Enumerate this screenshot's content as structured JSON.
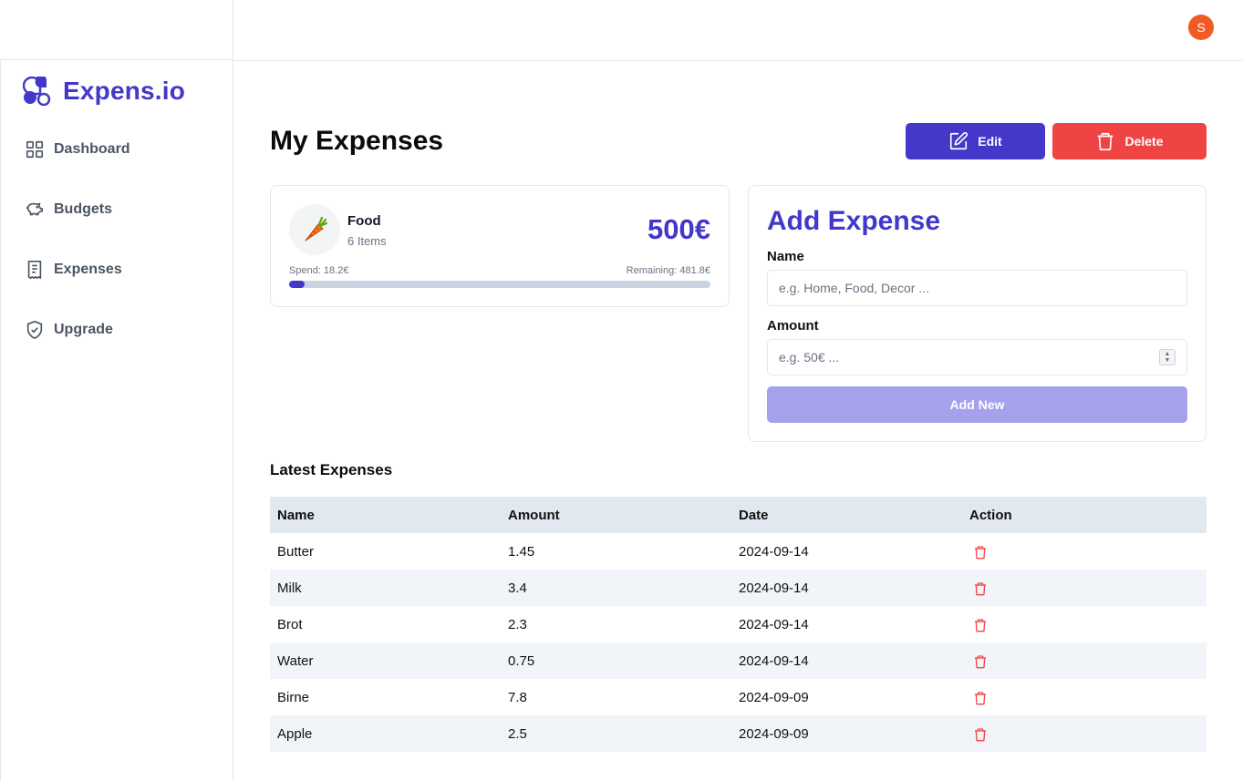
{
  "app": {
    "name": "Expens.io",
    "user_initial": "S"
  },
  "colors": {
    "brand": "#4338ca",
    "danger": "#ef4444",
    "avatar": "#f15a24",
    "add_button": "#a5a1ec"
  },
  "sidebar": {
    "items": [
      {
        "label": "Dashboard",
        "icon": "grid-icon"
      },
      {
        "label": "Budgets",
        "icon": "piggy-bank-icon"
      },
      {
        "label": "Expenses",
        "icon": "receipt-icon"
      },
      {
        "label": "Upgrade",
        "icon": "shield-check-icon"
      }
    ]
  },
  "header": {
    "title": "My Expenses",
    "edit_label": "Edit",
    "delete_label": "Delete"
  },
  "budget": {
    "name": "Food",
    "items_count": "6 Items",
    "amount": "500€",
    "spend_label": "Spend: 18.2€",
    "remaining_label": "Remaining: 481.8€",
    "progress_fraction": 0.0364,
    "icon": "carrot-icon"
  },
  "add_expense": {
    "title": "Add Expense",
    "name_label": "Name",
    "name_placeholder": "e.g. Home, Food, Decor ...",
    "amount_label": "Amount",
    "amount_placeholder": "e.g. 50€ ...",
    "button_label": "Add New"
  },
  "latest": {
    "title": "Latest Expenses",
    "columns": [
      "Name",
      "Amount",
      "Date",
      "Action"
    ],
    "rows": [
      {
        "name": "Butter",
        "amount": "1.45",
        "date": "2024-09-14"
      },
      {
        "name": "Milk",
        "amount": "3.4",
        "date": "2024-09-14"
      },
      {
        "name": "Brot",
        "amount": "2.3",
        "date": "2024-09-14"
      },
      {
        "name": "Water",
        "amount": "0.75",
        "date": "2024-09-14"
      },
      {
        "name": "Birne",
        "amount": "7.8",
        "date": "2024-09-09"
      },
      {
        "name": "Apple",
        "amount": "2.5",
        "date": "2024-09-09"
      }
    ]
  }
}
